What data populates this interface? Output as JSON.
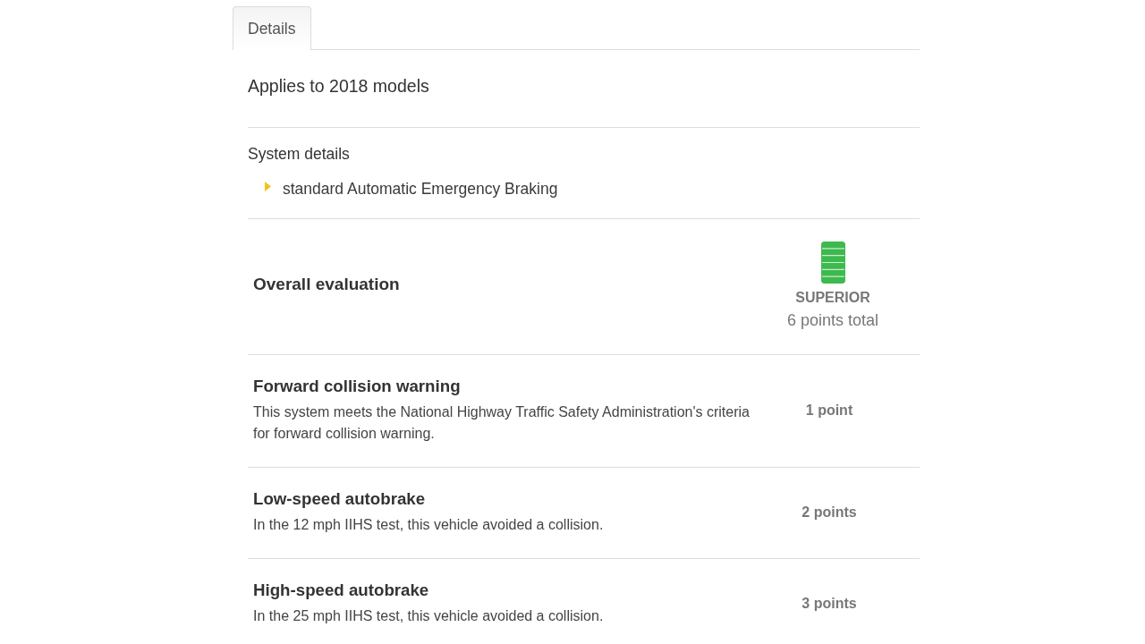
{
  "tabs": [
    {
      "label": "Details",
      "selected": true
    }
  ],
  "applies_to": "Applies to 2018 models",
  "system_details": {
    "heading": "System details",
    "items": [
      "standard Automatic Emergency Braking"
    ]
  },
  "overall": {
    "label": "Overall evaluation",
    "level": 1,
    "rating": "SUPERIOR",
    "total": "6 points total"
  },
  "criteria": [
    {
      "title": "Forward collision warning",
      "description": "This system meets the National Highway Traffic Safety Administration's criteria for forward collision warning.",
      "points": "1 point"
    },
    {
      "title": "Low-speed autobrake",
      "description": "In the 12 mph IIHS test, this vehicle avoided a collision.",
      "points": "2 points"
    },
    {
      "title": "High-speed autobrake",
      "description": "In the 25 mph IIHS test, this vehicle avoided a collision.",
      "points": "3 points"
    }
  ]
}
